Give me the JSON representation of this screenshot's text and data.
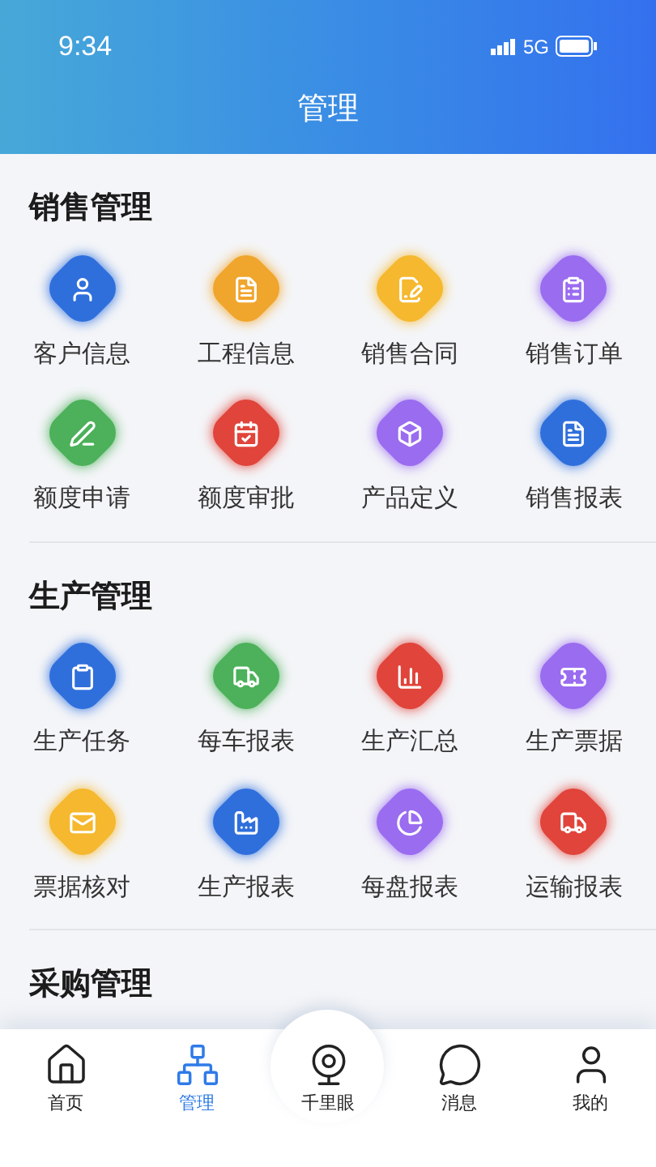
{
  "status_bar": {
    "time": "9:34",
    "network": "5G"
  },
  "header": {
    "title": "管理"
  },
  "sections": [
    {
      "title": "销售管理",
      "items": [
        {
          "label": "客户信息",
          "color": "#2f6fdc"
        },
        {
          "label": "工程信息",
          "color": "#f0a52c"
        },
        {
          "label": "销售合同",
          "color": "#f5b82e"
        },
        {
          "label": "销售订单",
          "color": "#9a6cf0"
        },
        {
          "label": "额度申请",
          "color": "#4cb15a"
        },
        {
          "label": "额度审批",
          "color": "#e0443a"
        },
        {
          "label": "产品定义",
          "color": "#9a6cf0"
        },
        {
          "label": "销售报表",
          "color": "#2f6fdc"
        }
      ]
    },
    {
      "title": "生产管理",
      "items": [
        {
          "label": "生产任务",
          "color": "#2f6fdc"
        },
        {
          "label": "每车报表",
          "color": "#4cb15a"
        },
        {
          "label": "生产汇总",
          "color": "#e0443a"
        },
        {
          "label": "生产票据",
          "color": "#9a6cf0"
        },
        {
          "label": "票据核对",
          "color": "#f5b82e"
        },
        {
          "label": "生产报表",
          "color": "#2f6fdc"
        },
        {
          "label": "每盘报表",
          "color": "#9a6cf0"
        },
        {
          "label": "运输报表",
          "color": "#e0443a"
        }
      ]
    },
    {
      "title": "采购管理"
    }
  ],
  "tab_bar": [
    {
      "label": "首页",
      "selected": false
    },
    {
      "label": "管理",
      "selected": true
    },
    {
      "label": "千里眼",
      "selected": false
    },
    {
      "label": "消息",
      "selected": false
    },
    {
      "label": "我的",
      "selected": false
    }
  ]
}
